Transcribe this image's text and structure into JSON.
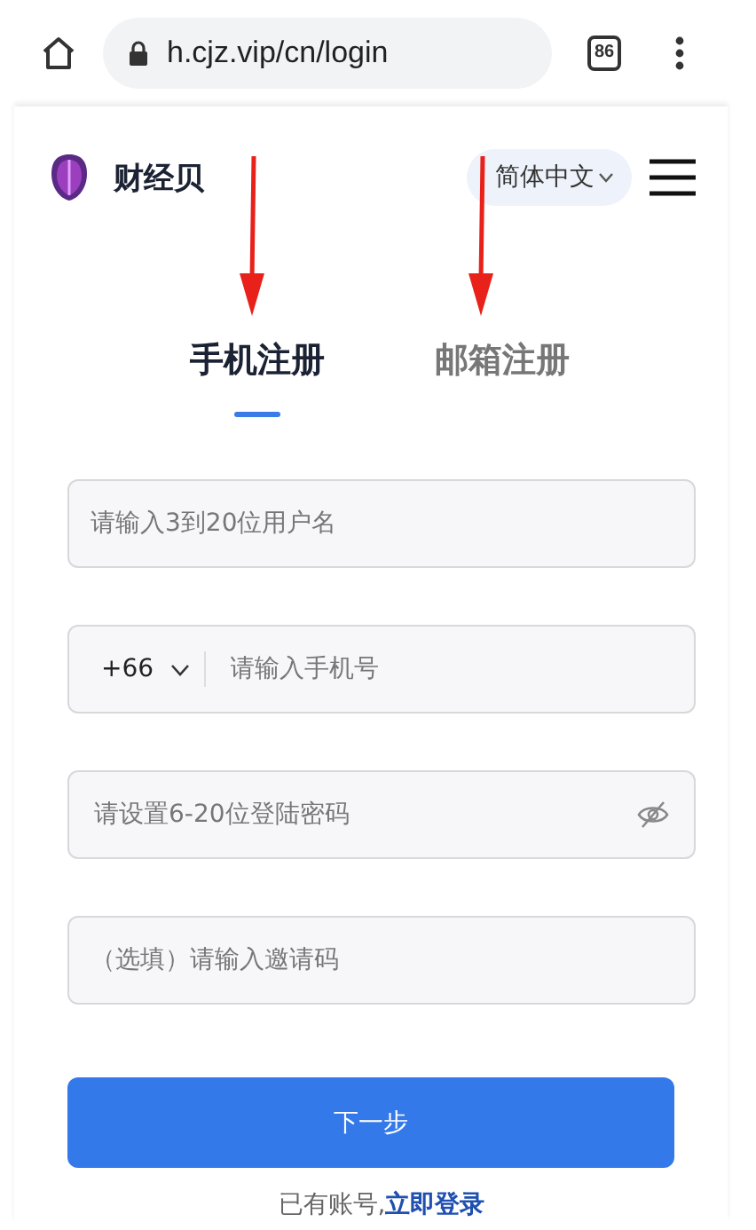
{
  "browser": {
    "url": "h.cjz.vip/cn/login",
    "tab_count": "86"
  },
  "header": {
    "brand": "财经贝",
    "language": "简体中文"
  },
  "tabs": [
    {
      "label": "手机注册",
      "selected": true
    },
    {
      "label": "邮箱注册",
      "selected": false
    }
  ],
  "fields": [
    {
      "kind": "text",
      "placeholder": "请输入3到20位用户名"
    },
    {
      "kind": "phone",
      "country_code": "+66",
      "placeholder": "请输入手机号"
    },
    {
      "kind": "password",
      "placeholder": "请设置6-20位登陆密码"
    },
    {
      "kind": "text",
      "placeholder": "（选填）请输入邀请码"
    }
  ],
  "submit": "下一步",
  "footer": {
    "text": "已有账号,",
    "link": "立即登录"
  }
}
